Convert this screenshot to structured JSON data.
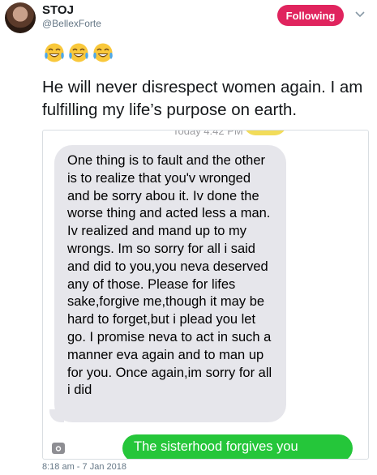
{
  "author": {
    "display_name": "STOJ",
    "handle": "@BellexForte"
  },
  "follow_button_label": "Following",
  "tweet": {
    "text": "He will never disrespect women again. I am fulfilling my life’s purpose on earth.",
    "timestamp": "8:18 am - 7 Jan 2018"
  },
  "screenshot": {
    "top_time": "Today 4:42 PM",
    "incoming_message": "One thing is to fault and the other is to realize that you'v wronged and be sorry abou it. Iv done the worse thing and acted less a man. Iv realized and mand up to my wrongs. Im so sorry for all i said and did to you,you neva deserved any of those. Please for lifes sake,forgive me,though it may be hard to forget,but i plead you let go. I promise neva to act in such a manner eva again and to man up for you. Once again,im sorry for all i did",
    "outgoing_message": "The sisterhood forgives you"
  },
  "colors": {
    "follow_button": "#e0245e",
    "outgoing_bubble": "#25c63a",
    "incoming_bubble": "#e6e6eb"
  }
}
